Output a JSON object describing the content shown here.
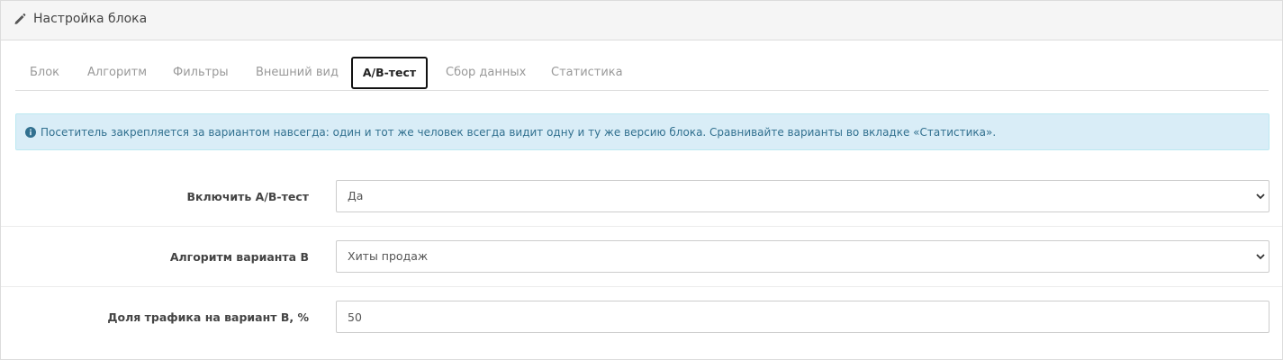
{
  "panel": {
    "title": "Настройка блока",
    "icon": "pencil-icon"
  },
  "tabs": [
    {
      "label": "Блок",
      "active": false
    },
    {
      "label": "Алгоритм",
      "active": false
    },
    {
      "label": "Фильтры",
      "active": false
    },
    {
      "label": "Внешний вид",
      "active": false
    },
    {
      "label": "A/B-тест",
      "active": true
    },
    {
      "label": "Сбор данных",
      "active": false
    },
    {
      "label": "Статистика",
      "active": false
    }
  ],
  "alert": {
    "icon": "info-circle-icon",
    "text": "Посетитель закрепляется за вариантом навсегда: один и тот же человек всегда видит одну и ту же версию блока. Сравнивайте варианты во вкладке «Статистика».",
    "color": "#31708f",
    "background": "#d9edf7"
  },
  "form": {
    "enable_ab": {
      "label": "Включить A/B-тест",
      "value": "Да"
    },
    "variant_b_algorithm": {
      "label": "Алгоритм варианта B",
      "value": "Хиты продаж"
    },
    "traffic_share": {
      "label": "Доля трафика на вариант B, %",
      "value": "50"
    }
  }
}
